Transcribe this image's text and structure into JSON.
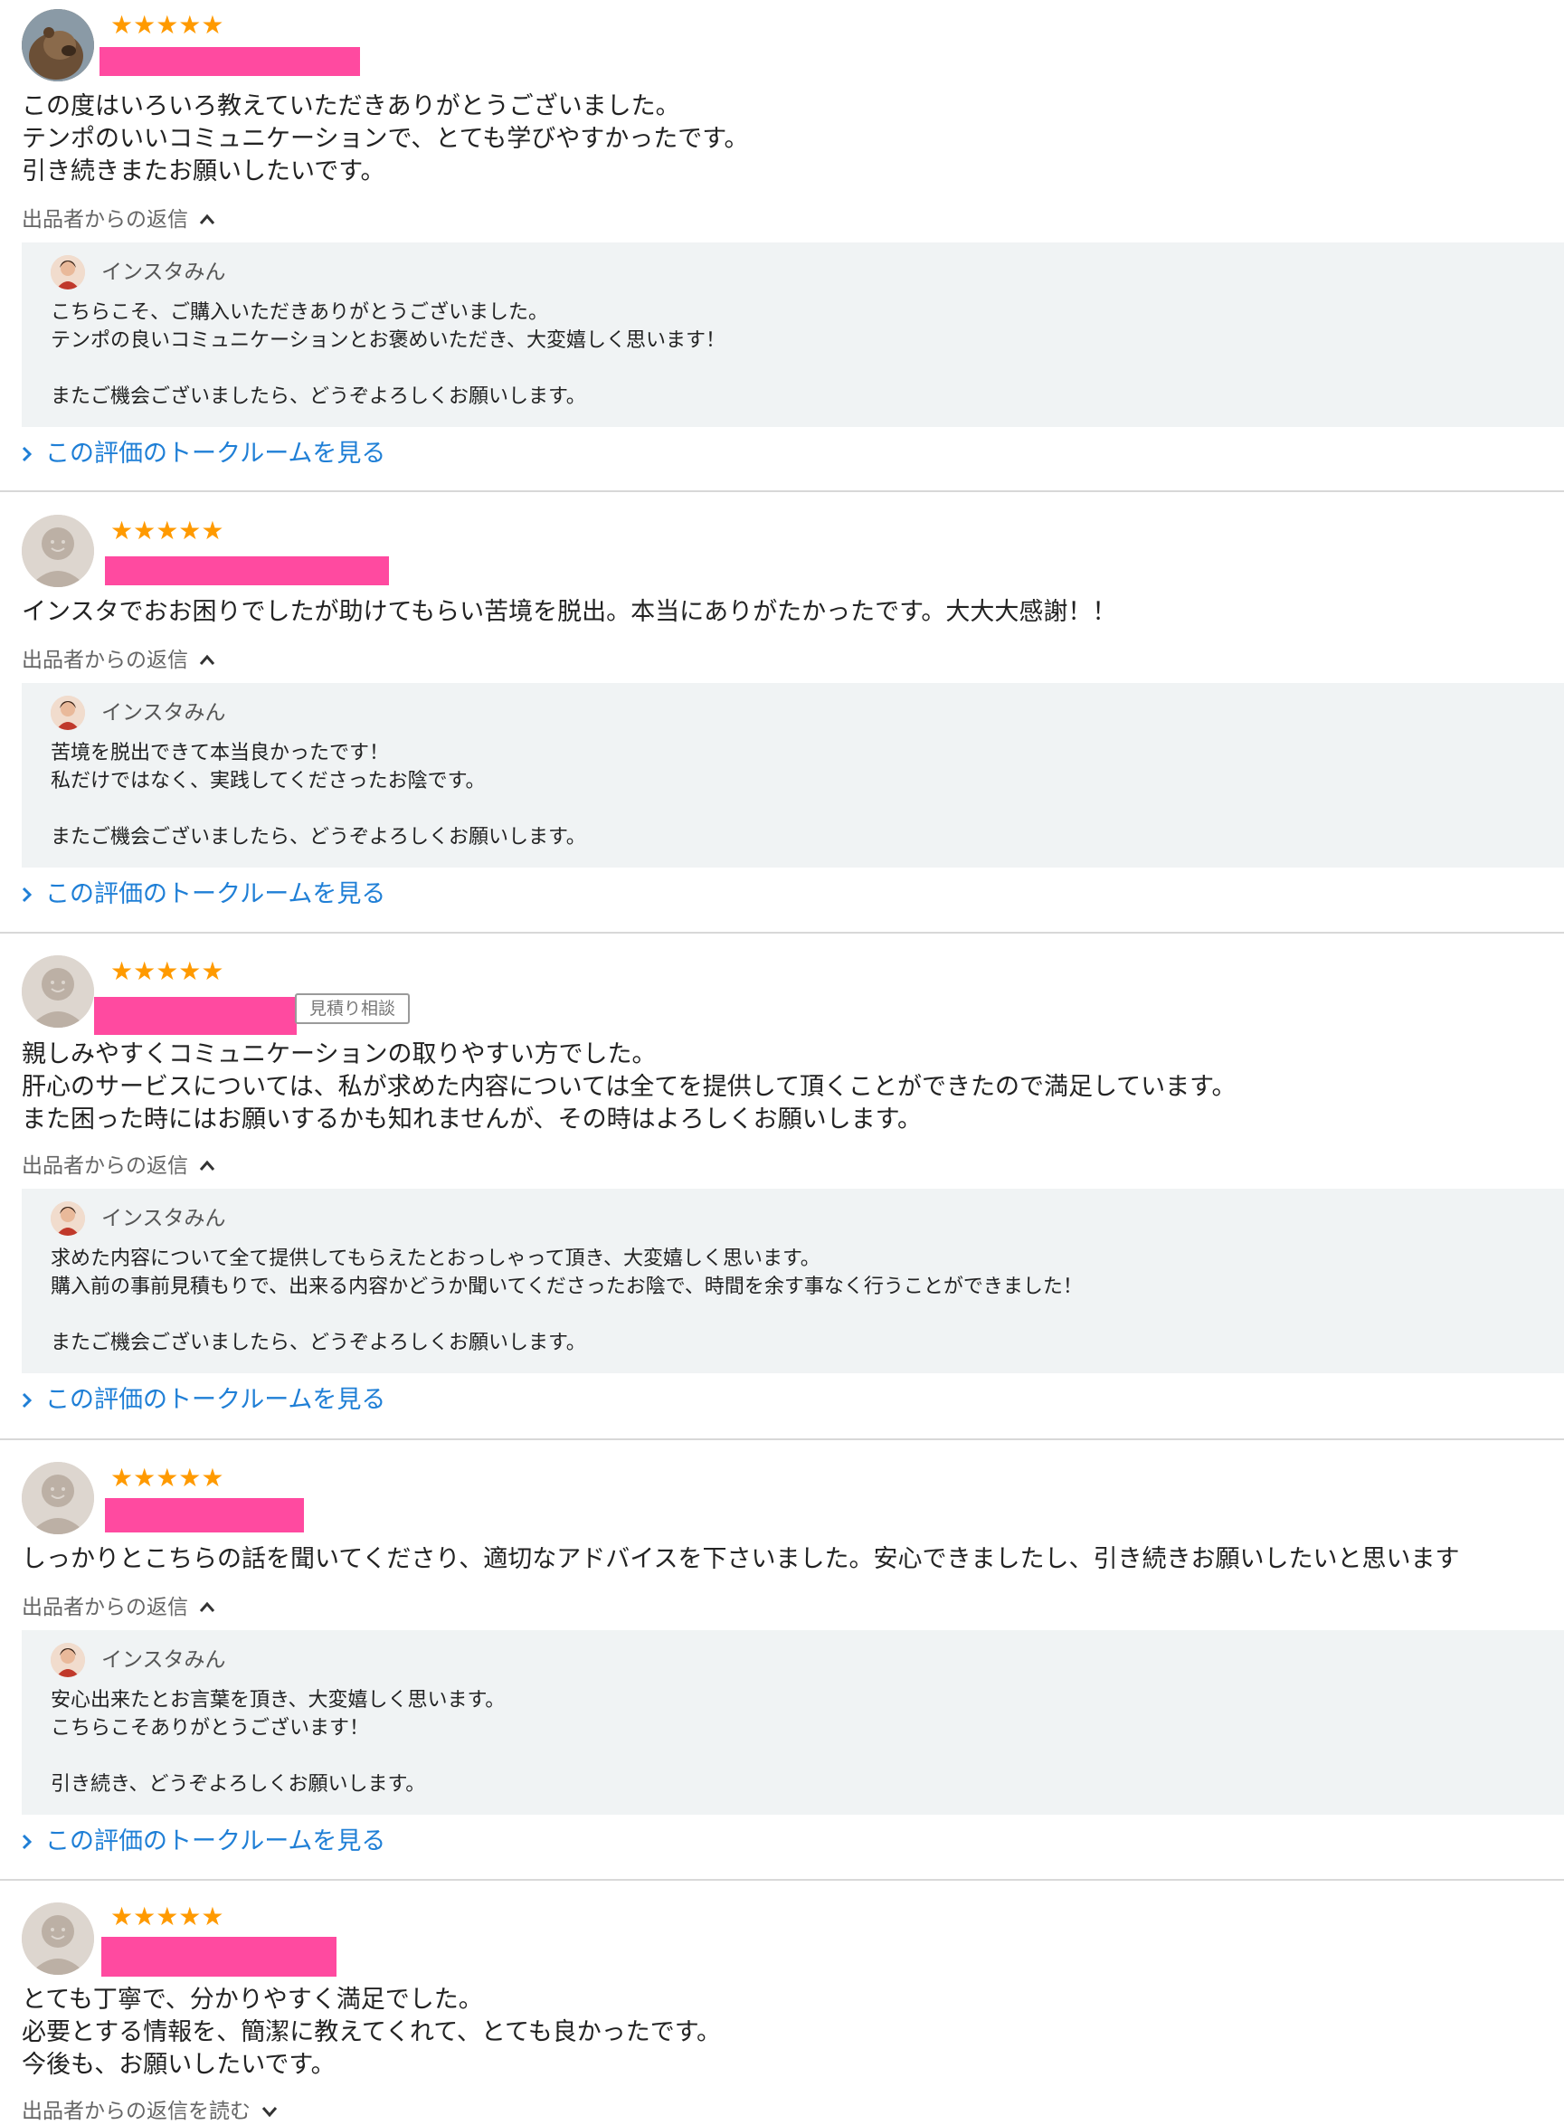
{
  "colors": {
    "star": "#ff9a00",
    "redaction": "#ff4aa0",
    "link": "#1f7fd6",
    "reply_background": "#f0f3f4",
    "separator": "#d8d8d8"
  },
  "icons": {
    "star": "star-icon",
    "chevron_up": "chevron-up-icon",
    "chevron_down": "chevron-down-icon",
    "chevron_right": "chevron-right-icon"
  },
  "reviews": [
    {
      "rating": 5,
      "stars": "★★★★★",
      "badge": "",
      "text_lines": [
        "この度はいろいろ教えていただきありがとうございました。",
        "テンポのいいコミュニケーションで、とても学びやすかったです。",
        "引き続きまたお願いしたいです。"
      ],
      "reply_toggle_label": "出品者からの返信",
      "seller_name": "インスタみん",
      "reply_lines": [
        "こちらこそ、ご購入いただきありがとうございました。",
        "テンポの良いコミュニケーションとお褒めいただき、大変嬉しく思います！",
        "",
        "またご機会ございましたら、どうぞよろしくお願いします。"
      ],
      "talk_link": "この評価のトークルームを見る"
    },
    {
      "rating": 5,
      "stars": "★★★★★",
      "badge": "",
      "text_lines": [
        "インスタでおお困りでしたが助けてもらい苦境を脱出。本当にありがたかったです。大大大感謝！！"
      ],
      "reply_toggle_label": "出品者からの返信",
      "seller_name": "インスタみん",
      "reply_lines": [
        "苦境を脱出できて本当良かったです！",
        "私だけではなく、実践してくださったお陰です。",
        "",
        "またご機会ございましたら、どうぞよろしくお願いします。"
      ],
      "talk_link": "この評価のトークルームを見る"
    },
    {
      "rating": 5,
      "stars": "★★★★★",
      "badge": "見積り相談",
      "text_lines": [
        "親しみやすくコミュニケーションの取りやすい方でした。",
        "肝心のサービスについては、私が求めた内容については全てを提供して頂くことができたので満足しています。",
        "また困った時にはお願いするかも知れませんが、その時はよろしくお願いします。"
      ],
      "reply_toggle_label": "出品者からの返信",
      "seller_name": "インスタみん",
      "reply_lines": [
        "求めた内容について全て提供してもらえたとおっしゃって頂き、大変嬉しく思います。",
        "購入前の事前見積もりで、出来る内容かどうか聞いてくださったお陰で、時間を余す事なく行うことができました！",
        "",
        "またご機会ございましたら、どうぞよろしくお願いします。"
      ],
      "talk_link": "この評価のトークルームを見る"
    },
    {
      "rating": 5,
      "stars": "★★★★★",
      "badge": "",
      "text_lines": [
        "しっかりとこちらの話を聞いてくださり、適切なアドバイスを下さいました。安心できましたし、引き続きお願いしたいと思います"
      ],
      "reply_toggle_label": "出品者からの返信",
      "seller_name": "インスタみん",
      "reply_lines": [
        "安心出来たとお言葉を頂き、大変嬉しく思います。",
        "こちらこそありがとうございます！",
        "",
        "引き続き、どうぞよろしくお願いします。"
      ],
      "talk_link": "この評価のトークルームを見る"
    },
    {
      "rating": 5,
      "stars": "★★★★★",
      "badge": "",
      "text_lines": [
        "とても丁寧で、分かりやすく満足でした。",
        "必要とする情報を、簡潔に教えてくれて、とても良かったです。",
        "今後も、お願いしたいです。"
      ],
      "reply_toggle_label": "出品者からの返信を読む"
    }
  ]
}
